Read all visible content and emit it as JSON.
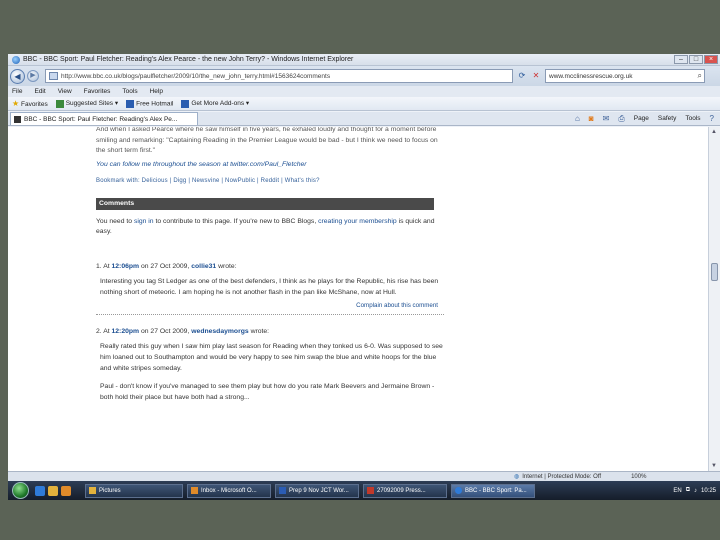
{
  "window": {
    "title": "BBC - BBC Sport: Paul Fletcher: Reading's Alex Pearce - the new John Terry? - Windows Internet Explorer"
  },
  "address": {
    "url": "http://www.bbc.co.uk/blogs/paulfletcher/2009/10/the_new_john_terry.html#1563624comments",
    "search_text": "www.mcclinessrescue.org.uk"
  },
  "menu": [
    "File",
    "Edit",
    "View",
    "Favorites",
    "Tools",
    "Help"
  ],
  "favorites": {
    "label": "Favorites",
    "items": [
      "Suggested Sites",
      "Free Hotmail",
      "Get More Add-ons"
    ]
  },
  "tab": {
    "title": "BBC - BBC Sport: Paul Fletcher: Reading's Alex Pe..."
  },
  "commands": [
    "Page",
    "Safety",
    "Tools"
  ],
  "article": {
    "para": "And when I asked Pearce where he saw himself in five years, he exhaled loudly and thought for a moment before smiling and remarking: \"Captaining Reading in the Premier League would be bad - but I think we need to focus on the short term first.\"",
    "twitter": "You can follow me throughout the season at twitter.com/Paul_Fletcher",
    "social": "Bookmark with: Delicious | Digg | Newsvine | NowPublic | Reddit | What's this?"
  },
  "comments": {
    "heading": "Comments",
    "signin": {
      "before": "You need to ",
      "link1": "sign in",
      "middle": " to contribute to this page. If you're new to BBC Blogs, ",
      "link2": "creating your membership",
      "after": " is quick and easy."
    },
    "items": [
      {
        "num": "1.",
        "at": "At",
        "time": "12:06pm",
        "date": "on 27 Oct 2009,",
        "user": "collie31",
        "wrote": "wrote:",
        "body": "Interesting you tag St Ledger as one of the best defenders, I think as he plays for the Republic, his rise has been nothing short of meteoric. I am hoping he is not another flash in the pan like McShane, now at Hull.",
        "complain": "Complain about this comment"
      },
      {
        "num": "2.",
        "at": "At",
        "time": "12:20pm",
        "date": "on 27 Oct 2009,",
        "user": "wednesdaymorgs",
        "wrote": "wrote:",
        "body": "Really rated this guy when I saw him play last season for Reading when they tonked us 6-0. Was supposed to see him loaned out to Southampton and would be very happy to see him swap the blue and white hoops for the blue and white stripes someday.",
        "body2": "Paul - don't know if you've managed to see them play but how do you rate Mark Beevers and Jermaine Brown - both hold their place but have both had a strong..."
      }
    ]
  },
  "status": {
    "zone": "Internet | Protected Mode: Off",
    "zoom": "100%"
  },
  "taskbar": {
    "buttons": [
      "Pictures",
      "Inbox - Microsoft O...",
      "Prep 9 Nov JCT Wor...",
      "27092009 Press...",
      "BBC - BBC Sport: Pa..."
    ],
    "lang": "EN",
    "clock": "10:25"
  },
  "colors": {
    "link": "#1b4e91",
    "comments_header": "#4a4a4a",
    "chrome": "#dbe4f0"
  }
}
